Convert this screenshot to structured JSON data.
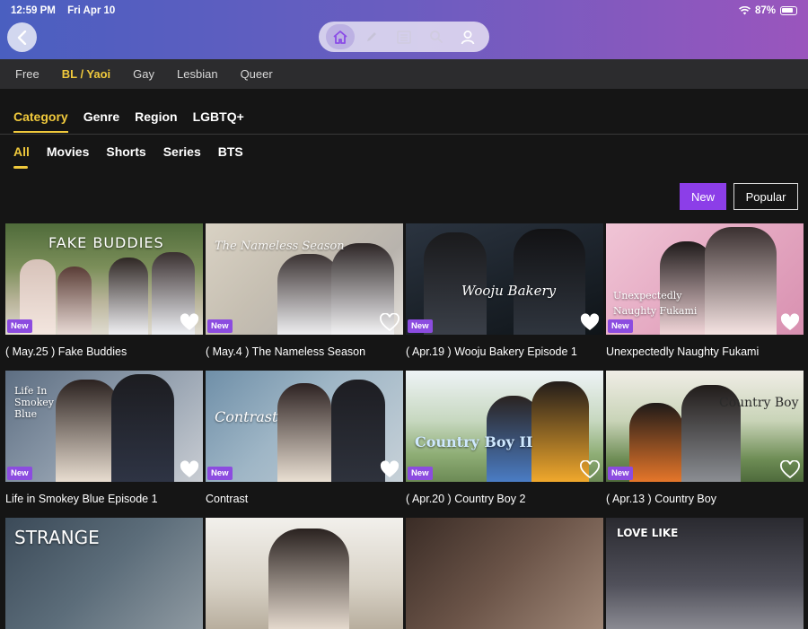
{
  "status": {
    "time": "12:59 PM",
    "date": "Fri Apr 10",
    "battery": "87%"
  },
  "nav": {
    "icons": [
      "home-icon",
      "pen-icon",
      "list-icon",
      "search-icon",
      "person-icon"
    ]
  },
  "subnav": [
    "Free",
    "BL / Yaoi",
    "Gay",
    "Lesbian",
    "Queer"
  ],
  "tabs_primary": [
    "Category",
    "Genre",
    "Region",
    "LGBTQ+"
  ],
  "tabs_secondary": [
    "All",
    "Movies",
    "Shorts",
    "Series",
    "BTS"
  ],
  "sort": {
    "new": "New",
    "popular": "Popular"
  },
  "badge": "New",
  "cards": [
    {
      "title": "( May.25 ) Fake Buddies",
      "art": "FAKE BUDDIES",
      "badge": true
    },
    {
      "title": "( May.4 ) The Nameless Season",
      "art": "The Nameless Season",
      "badge": true
    },
    {
      "title": "( Apr.19 ) Wooju Bakery Episode 1",
      "art": "Wooju Bakery",
      "badge": true
    },
    {
      "title": "Unexpectedly Naughty Fukami",
      "art": "Unexpectedly Naughty Fukami",
      "badge": true
    },
    {
      "title": "Life in Smokey Blue Episode 1",
      "art": "Life In Smokey Blue",
      "badge": true
    },
    {
      "title": "Contrast",
      "art": "Contrast",
      "badge": true
    },
    {
      "title": "( Apr.20 ) Country Boy 2",
      "art": "Country Boy II",
      "badge": true
    },
    {
      "title": "( Apr.13 ) Country Boy",
      "art": "Country Boy",
      "badge": true
    },
    {
      "title": "",
      "art": "STRANGE",
      "badge": false
    },
    {
      "title": "",
      "art": "",
      "badge": false
    },
    {
      "title": "",
      "art": "",
      "badge": false
    },
    {
      "title": "",
      "art": "LOVE LIKE",
      "badge": false
    }
  ]
}
